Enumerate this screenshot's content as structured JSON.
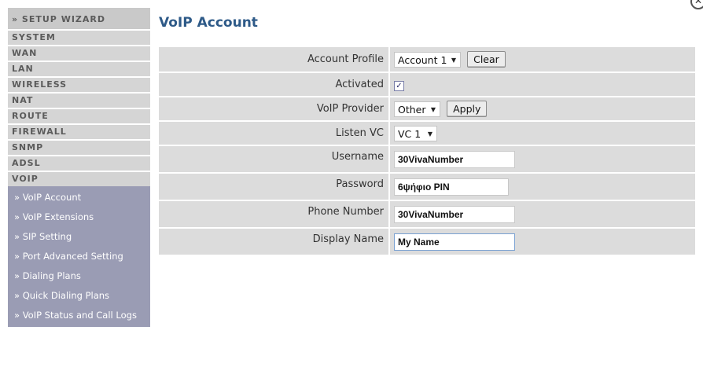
{
  "title": "VoIP Account",
  "sidebar": {
    "items": [
      {
        "label": "» SETUP WIZARD"
      },
      {
        "label": "SYSTEM"
      },
      {
        "label": "WAN"
      },
      {
        "label": "LAN"
      },
      {
        "label": "WIRELESS"
      },
      {
        "label": "NAT"
      },
      {
        "label": "ROUTE"
      },
      {
        "label": "FIREWALL"
      },
      {
        "label": "SNMP"
      },
      {
        "label": "ADSL"
      },
      {
        "label": "VOIP"
      }
    ],
    "subitems": [
      {
        "label": "» VoIP Account"
      },
      {
        "label": "» VoIP Extensions"
      },
      {
        "label": "» SIP Setting"
      },
      {
        "label": "» Port Advanced Setting"
      },
      {
        "label": "» Dialing Plans"
      },
      {
        "label": "» Quick Dialing Plans"
      },
      {
        "label": "» VoIP Status and Call Logs"
      }
    ]
  },
  "form": {
    "account_profile": {
      "label": "Account Profile",
      "value": "Account 1",
      "clear_label": "Clear"
    },
    "activated": {
      "label": "Activated",
      "checked": true
    },
    "voip_provider": {
      "label": "VoIP Provider",
      "value": "Other",
      "apply_label": "Apply"
    },
    "listen_vc": {
      "label": "Listen VC",
      "value": "VC 1"
    },
    "username": {
      "label": "Username",
      "value": "30VivaNumber"
    },
    "password": {
      "label": "Password",
      "value": "6ψήφιο PIN"
    },
    "phone_number": {
      "label": "Phone Number",
      "value": "30VivaNumber"
    },
    "display_name": {
      "label": "Display Name",
      "value": "My Name"
    }
  },
  "icons": {
    "dropdown": "chevron-down-icon",
    "check": "check-icon",
    "close": "close-icon"
  },
  "colors": {
    "title": "#2e5a88",
    "submenu_bg": "#9a9cb4",
    "row_bg": "#dcdcdc",
    "menu_bg": "#d5d5d5"
  }
}
